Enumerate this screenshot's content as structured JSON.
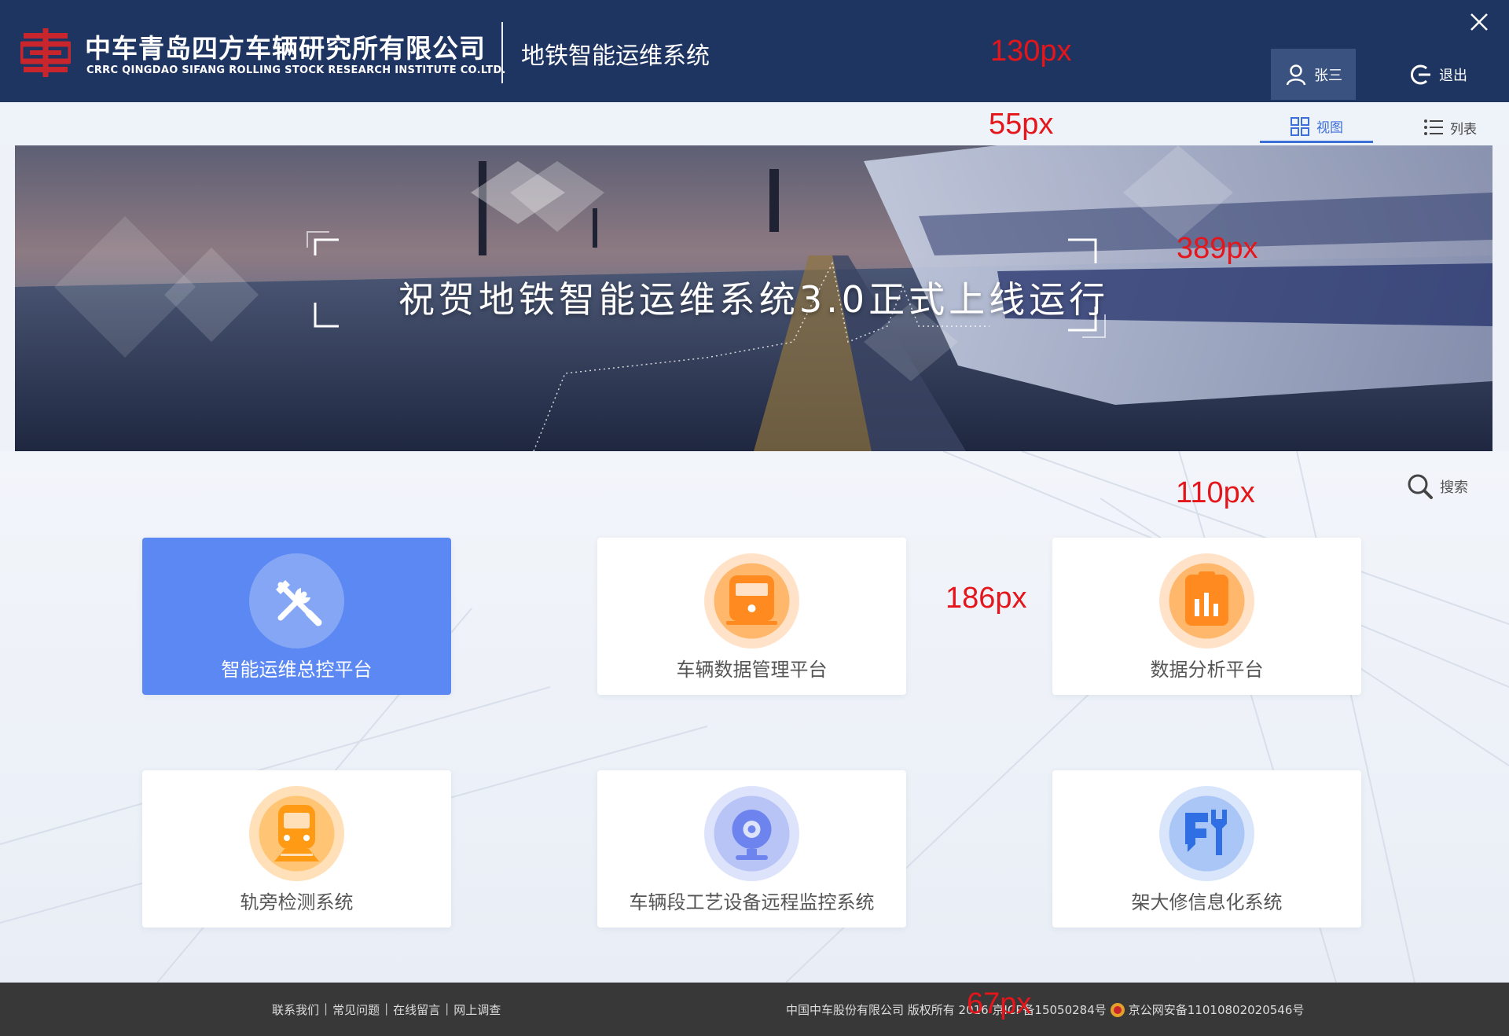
{
  "header": {
    "company_cn": "中车青岛四方车辆研究所有限公司",
    "company_en": "CRRC QINGDAO SIFANG ROLLING STOCK RESEARCH INSTITUTE CO.LTD.",
    "system_name": "地铁智能运维系统",
    "user_name": "张三",
    "logout_label": "退出",
    "height_note": "130px"
  },
  "view_toggle": {
    "view_label": "视图",
    "list_label": "列表",
    "height_note": "55px"
  },
  "banner": {
    "title": "祝贺地铁智能运维系统3.0正式上线运行",
    "height_note": "389px"
  },
  "main": {
    "search_label": "搜索",
    "spacing_note": "110px",
    "card_note": "186px",
    "cards": [
      {
        "label": "智能运维总控平台",
        "icon": "tools-icon",
        "active": true
      },
      {
        "label": "车辆数据管理平台",
        "icon": "train-front-icon",
        "color": "#ff9a3c"
      },
      {
        "label": "数据分析平台",
        "icon": "analytics-clipboard-icon",
        "color": "#ff9a3c"
      },
      {
        "label": "轨旁检测系统",
        "icon": "train-icon",
        "color": "#ffaa2e"
      },
      {
        "label": "车辆段工艺设备远程监控系统",
        "icon": "webcam-icon",
        "color": "#6d84ee"
      },
      {
        "label": "架大修信息化系统",
        "icon": "repair-icon",
        "color": "#4b8dee"
      }
    ]
  },
  "footer": {
    "links": [
      "联系我们",
      "常见问题",
      "在线留言",
      "网上调查"
    ],
    "copyright": "中国中车股份有限公司 版权所有 2016 京ICP备15050284号",
    "police_record": "京公网安备11010802020546号",
    "height_note": "67px"
  },
  "colors": {
    "header_bg": "#1f3561",
    "accent": "#3d6fd8",
    "active_card": "#5b88f2",
    "logo_red": "#c8252c",
    "note_red": "#e4161b",
    "footer_bg": "#383838"
  }
}
